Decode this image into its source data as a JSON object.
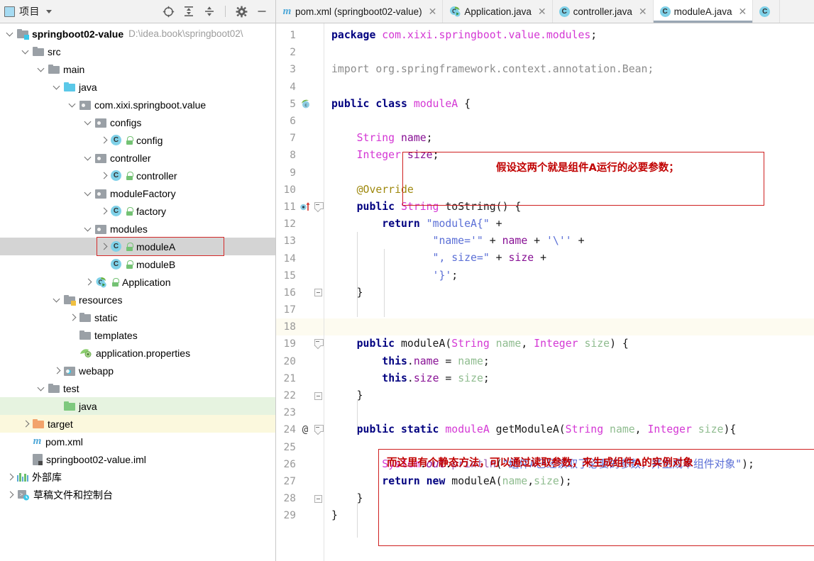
{
  "project_panel": {
    "title": "项目",
    "icon": "project-window-icon",
    "toolbar": [
      {
        "name": "select-opened-file-icon",
        "label": "定位"
      },
      {
        "name": "expand-all-icon",
        "label": "全部展开"
      },
      {
        "name": "collapse-all-icon",
        "label": "全部折叠"
      },
      {
        "name": "settings-gear-icon",
        "label": "设置"
      },
      {
        "name": "hide-panel-icon",
        "label": "隐藏"
      }
    ],
    "tree": [
      {
        "depth": 0,
        "arrow": "down",
        "icon": "module-folder",
        "label": "springboot02-value",
        "bold": true,
        "path": "D:\\idea.book\\springboot02\\"
      },
      {
        "depth": 1,
        "arrow": "down",
        "icon": "folder-gray",
        "label": "src"
      },
      {
        "depth": 2,
        "arrow": "down",
        "icon": "folder-gray",
        "label": "main"
      },
      {
        "depth": 3,
        "arrow": "down",
        "icon": "folder-blue",
        "label": "java"
      },
      {
        "depth": 4,
        "arrow": "down",
        "icon": "package",
        "label": "com.xixi.springboot.value"
      },
      {
        "depth": 5,
        "arrow": "down",
        "icon": "package",
        "label": "configs"
      },
      {
        "depth": 6,
        "arrow": "right",
        "icon": "class-c",
        "label": "config",
        "lock": true
      },
      {
        "depth": 5,
        "arrow": "down",
        "icon": "package",
        "label": "controller"
      },
      {
        "depth": 6,
        "arrow": "right",
        "icon": "class-c",
        "label": "controller",
        "lock": true
      },
      {
        "depth": 5,
        "arrow": "down",
        "icon": "package",
        "label": "moduleFactory"
      },
      {
        "depth": 6,
        "arrow": "right",
        "icon": "class-c",
        "label": "factory",
        "lock": true
      },
      {
        "depth": 5,
        "arrow": "down",
        "icon": "package",
        "label": "modules"
      },
      {
        "depth": 6,
        "arrow": "right",
        "icon": "class-c",
        "label": "moduleA",
        "lock": true,
        "selected": "gray",
        "annotated": true
      },
      {
        "depth": 6,
        "arrow": "none",
        "icon": "class-c",
        "label": "moduleB",
        "lock": true
      },
      {
        "depth": 5,
        "arrow": "right",
        "icon": "spring-class",
        "label": "Application",
        "lock": true
      },
      {
        "depth": 3,
        "arrow": "down",
        "icon": "resources-folder",
        "label": "resources"
      },
      {
        "depth": 4,
        "arrow": "right",
        "icon": "folder-gray",
        "label": "static"
      },
      {
        "depth": 4,
        "arrow": "none",
        "icon": "folder-gray",
        "label": "templates"
      },
      {
        "depth": 4,
        "arrow": "none",
        "icon": "properties-file",
        "label": "application.properties"
      },
      {
        "depth": 3,
        "arrow": "right",
        "icon": "webapp-folder",
        "label": "webapp"
      },
      {
        "depth": 2,
        "arrow": "down",
        "icon": "folder-gray",
        "label": "test"
      },
      {
        "depth": 3,
        "arrow": "none",
        "icon": "folder-green",
        "label": "java",
        "selected": "green"
      },
      {
        "depth": 1,
        "arrow": "right",
        "icon": "folder-orange",
        "label": "target",
        "selected": "yellow"
      },
      {
        "depth": 1,
        "arrow": "none",
        "icon": "maven-m",
        "label": "pom.xml"
      },
      {
        "depth": 1,
        "arrow": "none",
        "icon": "iml-file",
        "label": "springboot02-value.iml"
      },
      {
        "depth": 0,
        "arrow": "right",
        "icon": "library-icon",
        "label": "外部库"
      },
      {
        "depth": 0,
        "arrow": "right",
        "icon": "scratch-icon",
        "label": "草稿文件和控制台"
      }
    ]
  },
  "tabs": [
    {
      "label": "pom.xml (springboot02-value)",
      "icon": "maven-m",
      "active": false,
      "closable": true
    },
    {
      "label": "Application.java",
      "icon": "spring-class",
      "active": false,
      "closable": true
    },
    {
      "label": "controller.java",
      "icon": "class-c",
      "active": false,
      "closable": true
    },
    {
      "label": "moduleA.java",
      "icon": "class-c",
      "active": true,
      "closable": true
    },
    {
      "label": "",
      "icon": "class-c",
      "active": false,
      "closable": false
    }
  ],
  "editor": {
    "current_line": 18,
    "line_count": 29,
    "gutter_markers": [
      {
        "line": 5,
        "marker": "spring-bean-icon"
      },
      {
        "line": 11,
        "marker": "override-method-icon"
      },
      {
        "line": 24,
        "marker": "bean-at-icon",
        "text": "@"
      }
    ],
    "annotations": [
      {
        "name": "fields-note",
        "text": "假设这两个就是组件A运行的必要参数；",
        "color": "#c00000"
      },
      {
        "name": "static-factory-note",
        "text": "而这里有个静态方法，可以通过读取参数，来生成组件A的实例对象",
        "color": "#c00000"
      }
    ],
    "lines": [
      {
        "n": 1,
        "text": "package com.xixi.springboot.value.modules;"
      },
      {
        "n": 2,
        "text": ""
      },
      {
        "n": 3,
        "text": "import org.springframework.context.annotation.Bean;"
      },
      {
        "n": 4,
        "text": ""
      },
      {
        "n": 5,
        "text": "public class moduleA {"
      },
      {
        "n": 6,
        "text": ""
      },
      {
        "n": 7,
        "text": "    String name;"
      },
      {
        "n": 8,
        "text": "    Integer size;"
      },
      {
        "n": 9,
        "text": ""
      },
      {
        "n": 10,
        "text": "    @Override"
      },
      {
        "n": 11,
        "text": "    public String toString() {"
      },
      {
        "n": 12,
        "text": "        return \"moduleA{\" +"
      },
      {
        "n": 13,
        "text": "                \"name='\" + name + '\\'' +"
      },
      {
        "n": 14,
        "text": "                \", size=\" + size +"
      },
      {
        "n": 15,
        "text": "                '}';"
      },
      {
        "n": 16,
        "text": "    }"
      },
      {
        "n": 17,
        "text": ""
      },
      {
        "n": 18,
        "text": ""
      },
      {
        "n": 19,
        "text": "    public moduleA(String name, Integer size) {"
      },
      {
        "n": 20,
        "text": "        this.name = name;"
      },
      {
        "n": 21,
        "text": "        this.size = size;"
      },
      {
        "n": 22,
        "text": "    }"
      },
      {
        "n": 23,
        "text": ""
      },
      {
        "n": 24,
        "text": "    public static moduleA getModuleA(String name, Integer size){"
      },
      {
        "n": 25,
        "text": ""
      },
      {
        "n": 26,
        "text": "        System.out.println(\"组件A已经读取了必要的参数，并生成本组件对象\");"
      },
      {
        "n": 27,
        "text": "        return new moduleA(name,size);"
      },
      {
        "n": 28,
        "text": "    }"
      },
      {
        "n": 29,
        "text": "}"
      }
    ]
  },
  "colors": {
    "keyword": "#000080",
    "class_name": "#d437d4",
    "field": "#871094",
    "parameter": "#8fbc8f",
    "string": "#5b6fd6",
    "annotation": "#9e880d",
    "method": "#9a5fb0",
    "note_red": "#c00000",
    "selection_gray": "#d4d4d4",
    "current_line": "#fdfbf0"
  }
}
